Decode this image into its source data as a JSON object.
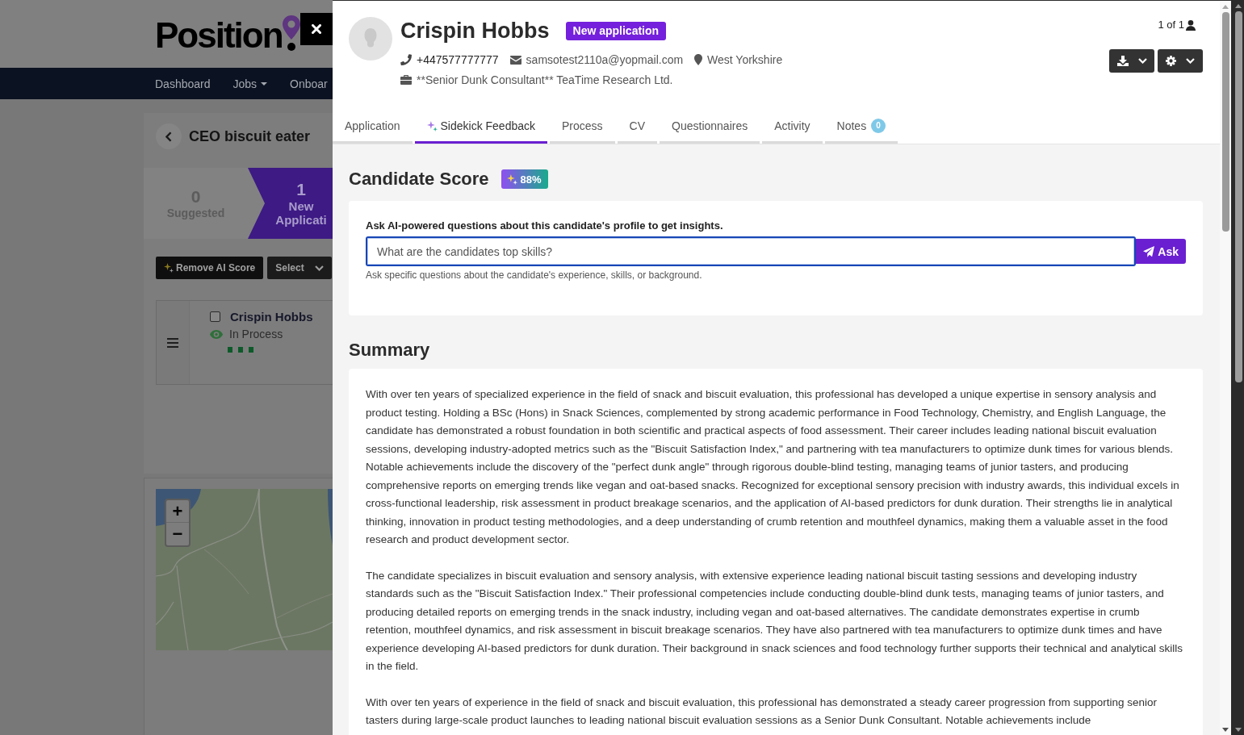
{
  "background_app": {
    "logo_text": "Position",
    "nav": [
      {
        "label": "Dashboard",
        "dropdown": false
      },
      {
        "label": "Jobs",
        "dropdown": true
      },
      {
        "label": "Onboar",
        "dropdown": false
      }
    ],
    "job_title": "CEO biscuit eater",
    "stages": [
      {
        "count": "0",
        "label": "Suggested",
        "selected": false
      },
      {
        "count": "1",
        "label": "New Applicati",
        "selected": true
      }
    ],
    "actions": [
      {
        "label": "Remove AI Score",
        "kind": "ai"
      },
      {
        "label": "Select",
        "kind": "menu"
      }
    ],
    "candidate_card": {
      "name": "Crispin Hobbs",
      "checked": false,
      "status": "In Process"
    },
    "map": {
      "zoom_in": "+",
      "zoom_out": "−"
    }
  },
  "panel": {
    "candidate": {
      "name": "Crispin Hobbs",
      "status_badge": "New application",
      "phone": "+447577777777",
      "email": "samsotest2110a@yopmail.com",
      "location": "West Yorkshire",
      "position": "**Senior Dunk Consultant** TeaTime Research Ltd."
    },
    "pager": "1 of 1",
    "tabs": [
      {
        "label": "Application",
        "kind": "plain",
        "selected": false
      },
      {
        "label": "Sidekick Feedback",
        "kind": "ai",
        "selected": true
      },
      {
        "label": "Process",
        "kind": "plain",
        "selected": false
      },
      {
        "label": "CV",
        "kind": "plain",
        "selected": false
      },
      {
        "label": "Questionnaires",
        "kind": "plain",
        "selected": false
      },
      {
        "label": "Activity",
        "kind": "plain",
        "selected": false
      },
      {
        "label": "Notes",
        "kind": "count",
        "count": "0",
        "selected": false
      }
    ],
    "score": {
      "title": "Candidate Score",
      "value": "88%"
    },
    "ask": {
      "label": "Ask AI-powered questions about this candidate's profile to get insights.",
      "value": "What are the candidates top skills?",
      "focused": true,
      "button": "Ask",
      "help": "Ask specific questions about the candidate's experience, skills, or background."
    },
    "summary": {
      "title": "Summary",
      "paragraphs": [
        "With over ten years of specialized experience in the field of snack and biscuit evaluation, this professional has developed a unique expertise in sensory analysis and product testing. Holding a BSc (Hons) in Snack Sciences, complemented by strong academic performance in Food Technology, Chemistry, and English Language, the candidate has demonstrated a robust foundation in both scientific and practical aspects of food assessment. Their career includes leading national biscuit evaluation sessions, developing industry-adopted metrics such as the \"Biscuit Satisfaction Index,\" and partnering with tea manufacturers to optimize dunk times for various blends. Notable achievements include the discovery of the \"perfect dunk angle\" through rigorous double-blind testing, managing teams of junior tasters, and producing comprehensive reports on emerging trends like vegan and oat-based snacks. Recognized for exceptional sensory precision with industry awards, this individual excels in cross-functional leadership, risk assessment in product breakage scenarios, and the application of AI-based predictors for dunk duration. Their strengths lie in analytical thinking, innovation in product testing methodologies, and a deep understanding of crumb retention and mouthfeel dynamics, making them a valuable asset in the food research and product development sector.",
        "The candidate specializes in biscuit evaluation and sensory analysis, with extensive experience leading national biscuit tasting sessions and developing industry standards such as the \"Biscuit Satisfaction Index.\" Their professional competencies include conducting double-blind dunk tests, managing teams of junior tasters, and producing detailed reports on emerging trends in the snack industry, including vegan and oat-based alternatives. The candidate demonstrates expertise in crumb retention, mouthfeel dynamics, and risk assessment in biscuit breakage scenarios. They have also partnered with tea manufacturers to optimize dunk times and have experience developing AI-based predictors for dunk duration. Their background in snack sciences and food technology further supports their technical and analytical skills in the field.",
        "With over ten years of experience in the field of snack and biscuit evaluation, this professional has demonstrated a steady career progression from supporting senior tasters during large-scale product launches to leading national biscuit evaluation sessions as a Senior Dunk Consultant. Notable achievements include"
      ]
    }
  }
}
